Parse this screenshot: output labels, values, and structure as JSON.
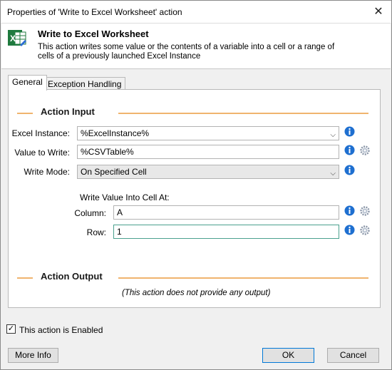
{
  "window": {
    "title": "Properties of 'Write to Excel Worksheet' action",
    "close_glyph": "✕"
  },
  "header": {
    "icon": "excel-icon",
    "title": "Write to Excel Worksheet",
    "description": "This action writes some value or the contents of a variable into a cell or a range of cells of a previously launched Excel Instance"
  },
  "tabs": [
    {
      "label": "General"
    },
    {
      "label": "Exception Handling"
    }
  ],
  "action_input": {
    "section_title": "Action Input",
    "excel_instance": {
      "label": "Excel Instance:",
      "value": "%ExcelInstance%"
    },
    "value_to_write": {
      "label": "Value to Write:",
      "value": "%CSVTable%"
    },
    "write_mode": {
      "label": "Write Mode:",
      "value": "On Specified Cell"
    },
    "write_value_heading": "Write Value Into Cell At:",
    "column": {
      "label": "Column:",
      "value": "A"
    },
    "row": {
      "label": "Row:",
      "value": "1"
    }
  },
  "action_output": {
    "section_title": "Action Output",
    "note": "(This action does not provide any output)"
  },
  "enabled_checkbox": {
    "label": "This action is Enabled",
    "checked": true
  },
  "buttons": {
    "more_info": "More Info",
    "ok": "OK",
    "cancel": "Cancel"
  },
  "colors": {
    "section_line": "#f0b46e",
    "info_icon": "#1e6fd0",
    "ok_border": "#0078d7"
  }
}
